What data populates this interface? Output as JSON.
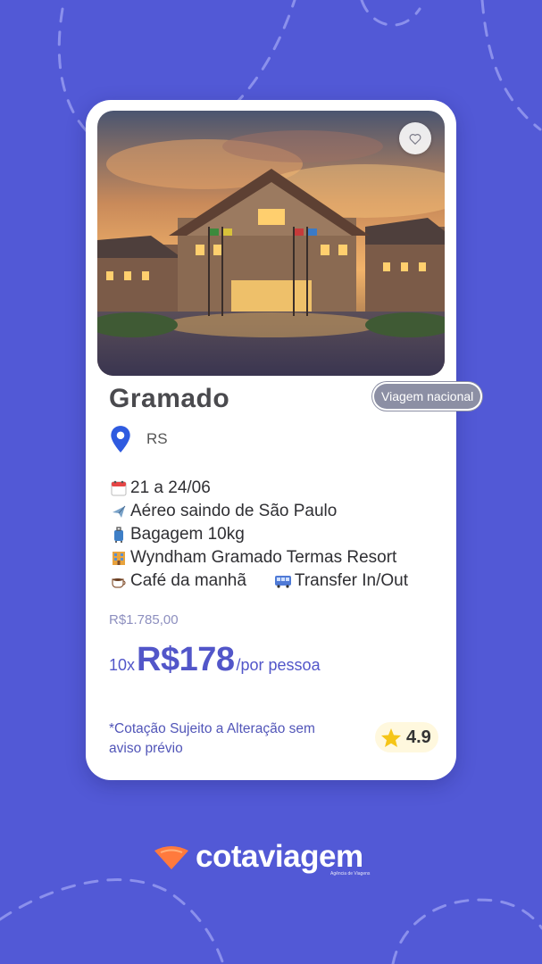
{
  "card": {
    "title": "Gramado",
    "badge": "Viagem nacional",
    "location": "RS",
    "details": [
      {
        "icon": "calendar-icon",
        "text": "21 a 24/06"
      },
      {
        "icon": "airplane-icon",
        "text": "Aéreo saindo de São Paulo"
      },
      {
        "icon": "luggage-icon",
        "text": "Bagagem 10kg"
      },
      {
        "icon": "hotel-icon",
        "text": "Wyndham Gramado Termas Resort"
      }
    ],
    "breakfast": {
      "icon": "coffee-icon",
      "text": "Café da manhã"
    },
    "transfer": {
      "icon": "bus-icon",
      "text": "Transfer In/Out"
    },
    "old_price": "R$1.785,00",
    "installments": "10x",
    "price": "R$178",
    "per_person": "/por pessoa",
    "disclaimer": "*Cotação Sujeito a Alteração sem aviso prévio",
    "rating": "4.9"
  },
  "brand": {
    "name": "cotaviagem",
    "tagline": "Agência de Viagens"
  },
  "colors": {
    "background": "#5259d6",
    "accent": "#5256c9",
    "logo": "#ff7a3d"
  }
}
